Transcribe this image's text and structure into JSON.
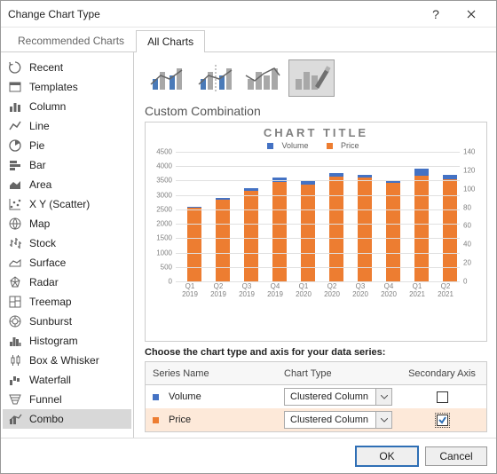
{
  "window": {
    "title": "Change Chart Type"
  },
  "tabs": {
    "recommended": "Recommended Charts",
    "all": "All Charts"
  },
  "sidebar": {
    "items": [
      {
        "label": "Recent",
        "icon": "recent"
      },
      {
        "label": "Templates",
        "icon": "templates"
      },
      {
        "label": "Column",
        "icon": "column"
      },
      {
        "label": "Line",
        "icon": "line"
      },
      {
        "label": "Pie",
        "icon": "pie"
      },
      {
        "label": "Bar",
        "icon": "bar"
      },
      {
        "label": "Area",
        "icon": "area"
      },
      {
        "label": "X Y (Scatter)",
        "icon": "scatter"
      },
      {
        "label": "Map",
        "icon": "map"
      },
      {
        "label": "Stock",
        "icon": "stock"
      },
      {
        "label": "Surface",
        "icon": "surface"
      },
      {
        "label": "Radar",
        "icon": "radar"
      },
      {
        "label": "Treemap",
        "icon": "treemap"
      },
      {
        "label": "Sunburst",
        "icon": "sunburst"
      },
      {
        "label": "Histogram",
        "icon": "histogram"
      },
      {
        "label": "Box & Whisker",
        "icon": "box"
      },
      {
        "label": "Waterfall",
        "icon": "waterfall"
      },
      {
        "label": "Funnel",
        "icon": "funnel"
      },
      {
        "label": "Combo",
        "icon": "combo"
      }
    ],
    "selected_index": 18
  },
  "section_title": "Custom Combination",
  "subtypes": {
    "selected_index": 3
  },
  "chart_data": {
    "type": "bar",
    "title": "CHART TITLE",
    "legend": [
      "Volume",
      "Price"
    ],
    "colors": {
      "Volume": "#4472C4",
      "Price": "#ED7D31"
    },
    "ylabel": "",
    "xlabel": "",
    "ylim": [
      0,
      4500
    ],
    "ytick": 500,
    "y2lim": [
      0,
      140
    ],
    "y2tick": 20,
    "categories": [
      "Q1 2019",
      "Q2 2019",
      "Q3 2019",
      "Q4 2019",
      "Q1 2020",
      "Q2 2020",
      "Q3 2020",
      "Q4 2020",
      "Q1 2021",
      "Q2 2021"
    ],
    "series": [
      {
        "name": "Volume",
        "axis": "primary",
        "values": [
          2600,
          2900,
          3250,
          3600,
          3500,
          3750,
          3700,
          3500,
          3900,
          3700
        ]
      },
      {
        "name": "Price",
        "axis": "secondary",
        "values": [
          80,
          88,
          98,
          107,
          105,
          113,
          112,
          106,
          114,
          110
        ]
      }
    ]
  },
  "series_section": {
    "heading": "Choose the chart type and axis for your data series:",
    "cols": {
      "name": "Series Name",
      "type": "Chart Type",
      "axis": "Secondary Axis"
    },
    "rows": [
      {
        "name": "Volume",
        "color": "#4472C4",
        "type": "Clustered Column",
        "secondary": false
      },
      {
        "name": "Price",
        "color": "#ED7D31",
        "type": "Clustered Column",
        "secondary": true
      }
    ],
    "selected_row": 1
  },
  "footer": {
    "ok": "OK",
    "cancel": "Cancel"
  }
}
